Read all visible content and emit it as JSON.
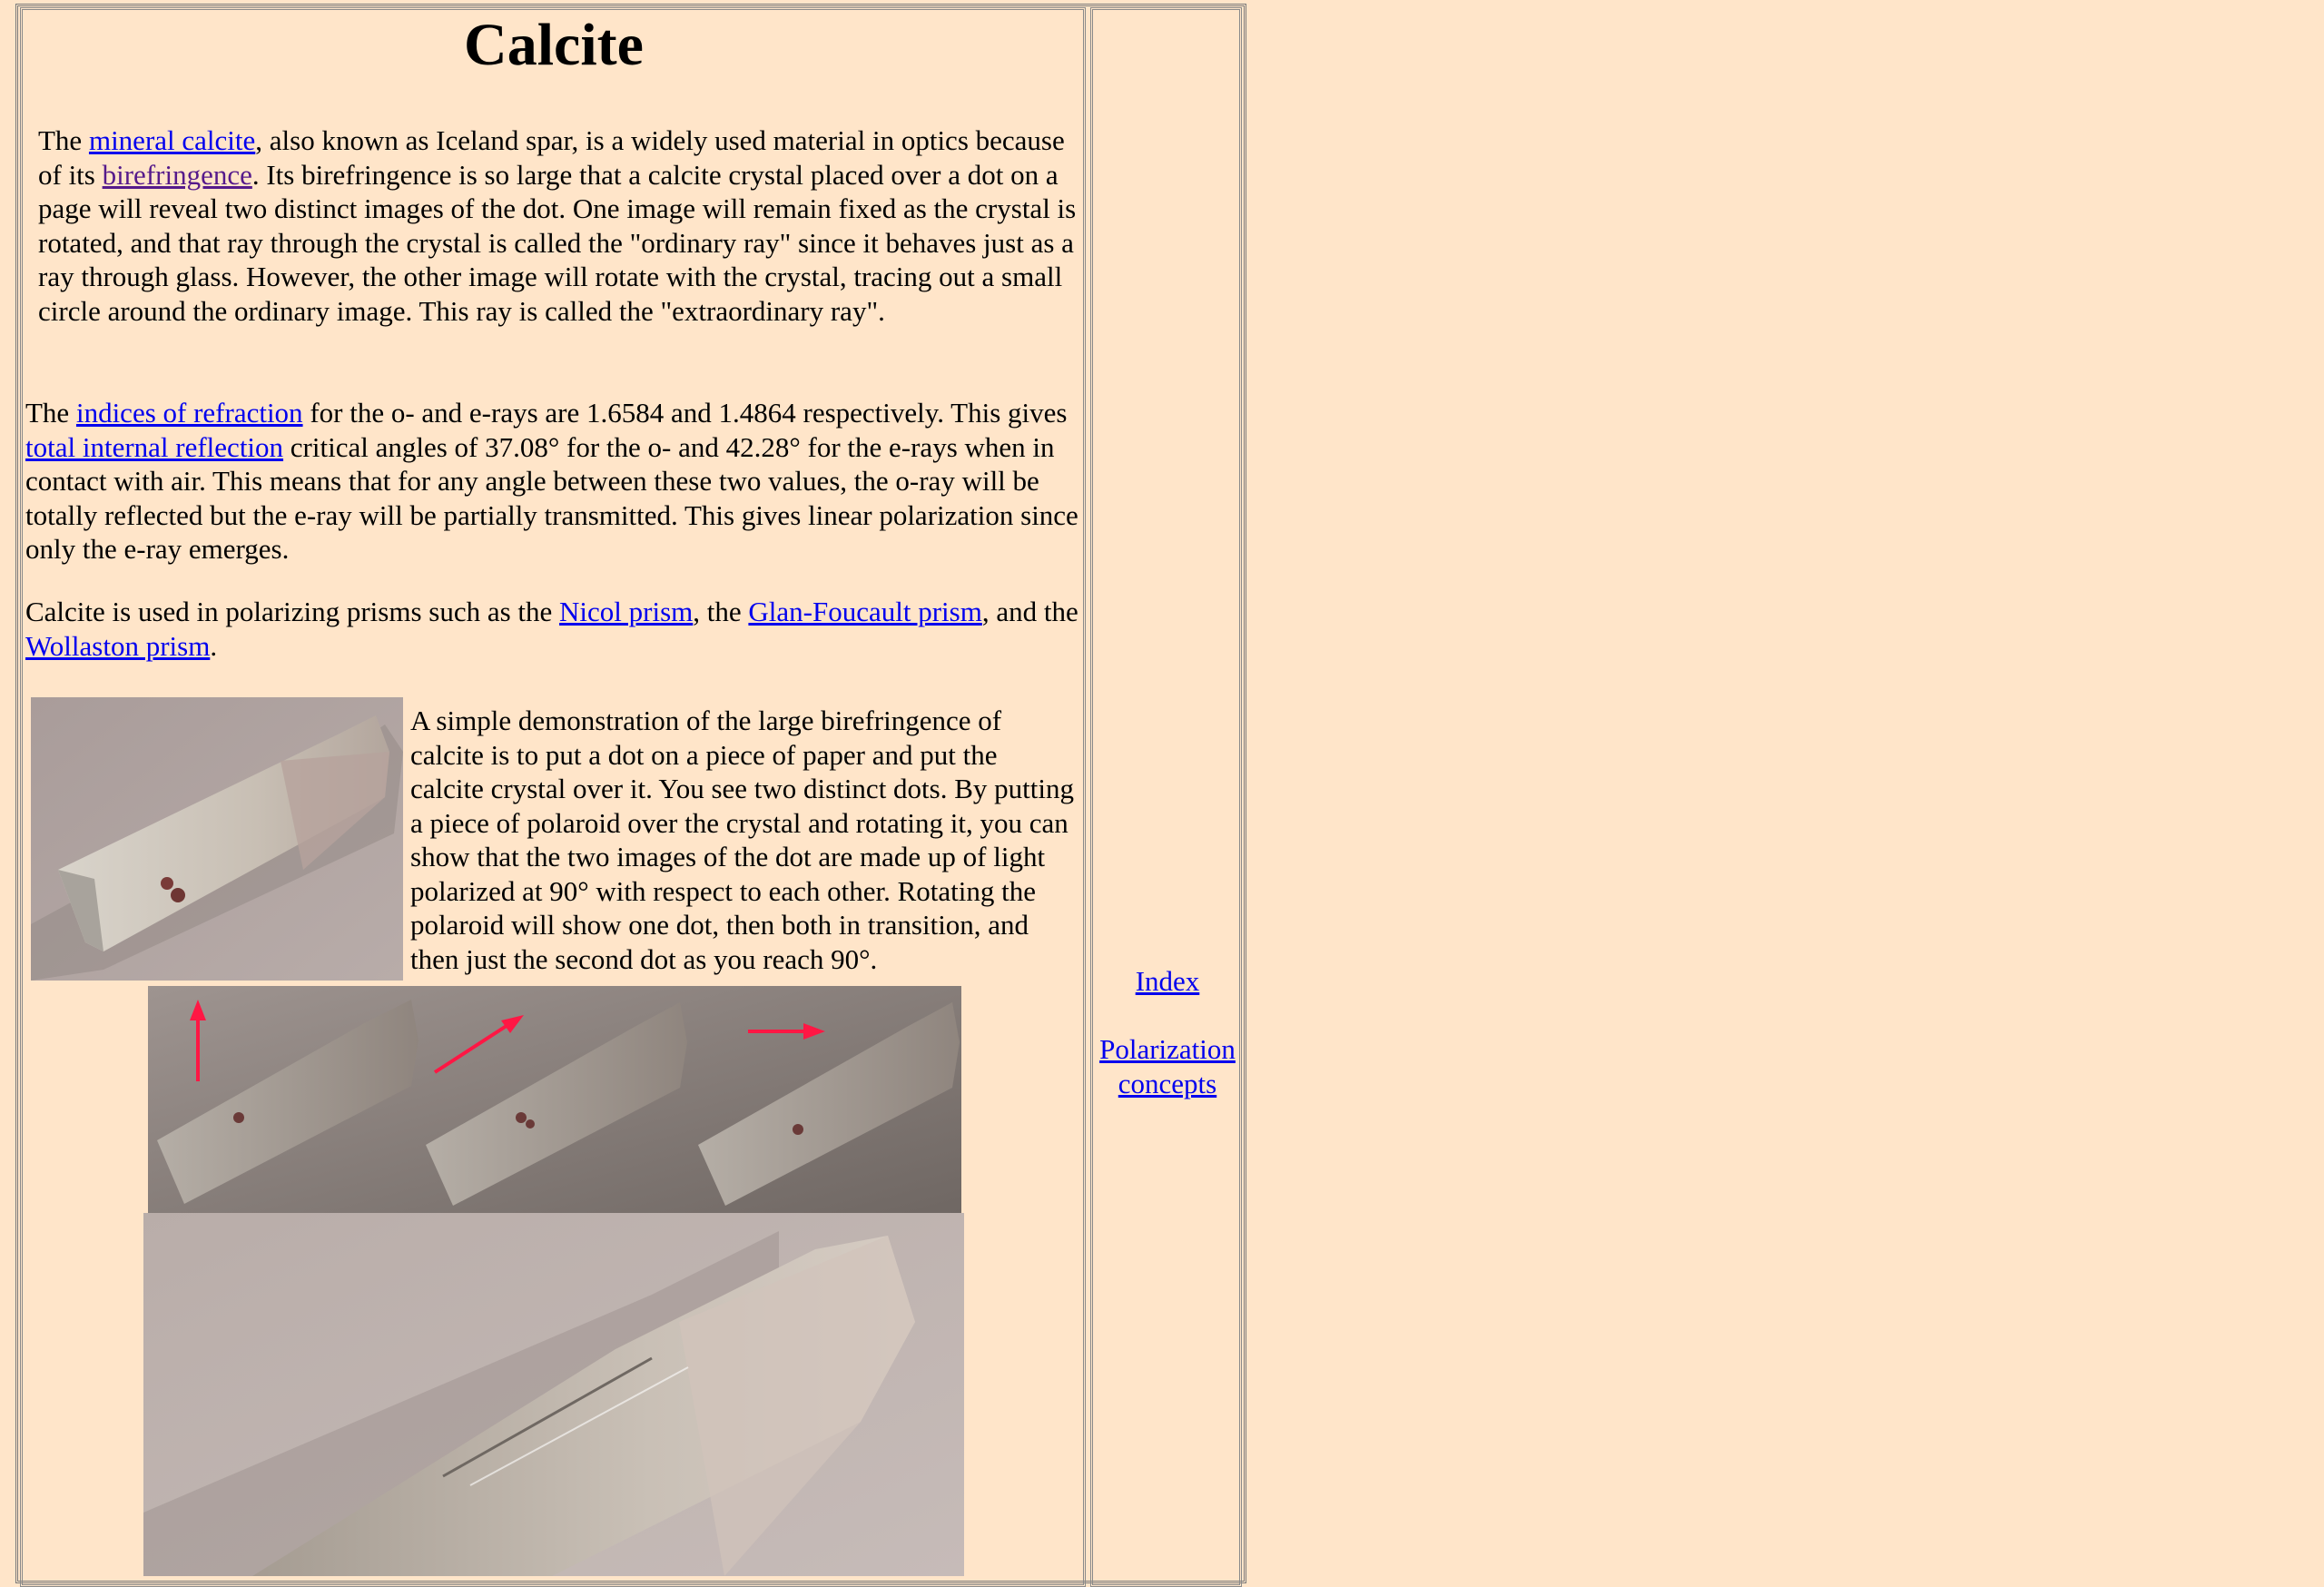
{
  "page": {
    "title": "Calcite"
  },
  "paragraph1": {
    "t1": "The ",
    "link_mineral": "mineral calcite",
    "t2": ", also known as Iceland spar, is a widely used material in optics because of its ",
    "link_birefringence": "birefringence",
    "t3": ". Its birefringence is so large that a calcite crystal placed over a dot on a page will reveal two distinct images of the dot. One image will remain fixed as the crystal is rotated, and that ray through the crystal is called the \"ordinary ray\" since it behaves just as a ray through glass. However, the other image will rotate with the crystal, tracing out a small circle around the ordinary image. This ray is called the \"extraordinary ray\"."
  },
  "paragraph2": {
    "t1": "The ",
    "link_indices": "indices of refraction",
    "t2": " for the o- and e-rays are 1.6584 and 1.4864 respectively. This gives ",
    "link_tir": "total internal reflection",
    "t3": " critical angles of 37.08° for the o- and 42.28° for the e-rays when in contact with air. This means that for any angle between these two values, the o-ray will be totally reflected but the e-ray will be partially transmitted. This gives linear polarization since only the e-ray emerges."
  },
  "paragraph3": {
    "t1": "Calcite is used in polarizing prisms such as the ",
    "link_nicol": "Nicol prism",
    "t2": ", the ",
    "link_glan": "Glan-Foucault prism",
    "t3": ", and the ",
    "link_wollaston": "Wollaston prism",
    "t4": "."
  },
  "paragraph4": {
    "text": "A simple demonstration of the large birefringence of calcite is to put a dot on a piece of paper and put the calcite crystal over it. You see two distinct dots. By putting a piece of polaroid over the crystal and rotating it, you can show that the two images of the dot are made up of light polarized at 90° with respect to each other. Rotating the polaroid will show one dot, then both in transition, and then just the second dot as you reach 90°."
  },
  "sidebar": {
    "index_link": "Index",
    "polarization_link": "Polarization concepts"
  },
  "colors": {
    "background": "#ffe5c9",
    "link": "#0000ee",
    "visited_link": "#551a8b",
    "arrow": "#ff1744"
  }
}
